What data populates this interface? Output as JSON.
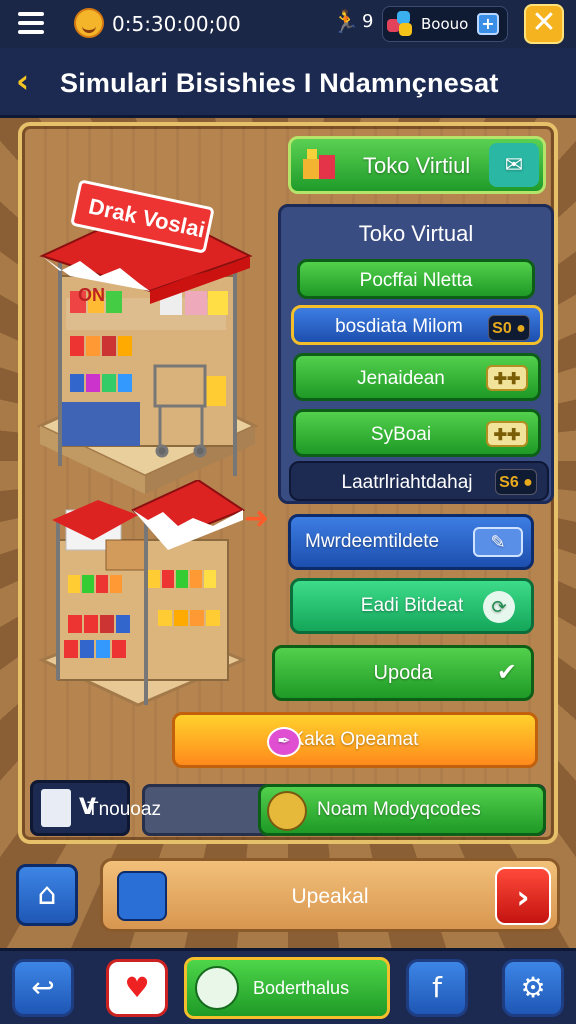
{
  "status_bar": {
    "clock": "0:5:30:00;00",
    "small_number": "9",
    "gems": "Boouo",
    "plus_label": "+",
    "close_label": "✕"
  },
  "header": {
    "back_icon": "chevron-left-icon",
    "title": "Simulari Bisishies I Ndamnçnesat"
  },
  "store_sign": "Drak Voslai",
  "store_mini_sign": "ON",
  "toko_header": {
    "label": "Toko Virtiul"
  },
  "menu": {
    "title": "Toko Virtual",
    "items": [
      {
        "label": "Pocffai Nletta",
        "style": "green"
      },
      {
        "label": "bosdiata Milom",
        "style": "blue",
        "badge": "S0"
      },
      {
        "label": "Jenaidean",
        "style": "green"
      },
      {
        "label": "SyBoai",
        "style": "green"
      },
      {
        "label": "Laatrlriahtdahaj",
        "style": "dark",
        "badge": "S6"
      }
    ]
  },
  "lower_menu": {
    "mwd": "Mwrdeemtildete",
    "eadi": "Eadi Bitdeat",
    "upoda": "Upoda",
    "kaka": "Kaka Opeamat"
  },
  "bottom_strip": {
    "left_text": "Tnouoaz",
    "left_v": "V",
    "right_text": "Noam Modyqcodes"
  },
  "action_bar": {
    "label": "Upeakal"
  },
  "nav": {
    "middle": "Boderthalus",
    "fb": "f"
  },
  "colors": {
    "accent": "#f6b320",
    "navy": "#1c2950",
    "green": "#2aa332",
    "blue": "#2a62c8"
  }
}
